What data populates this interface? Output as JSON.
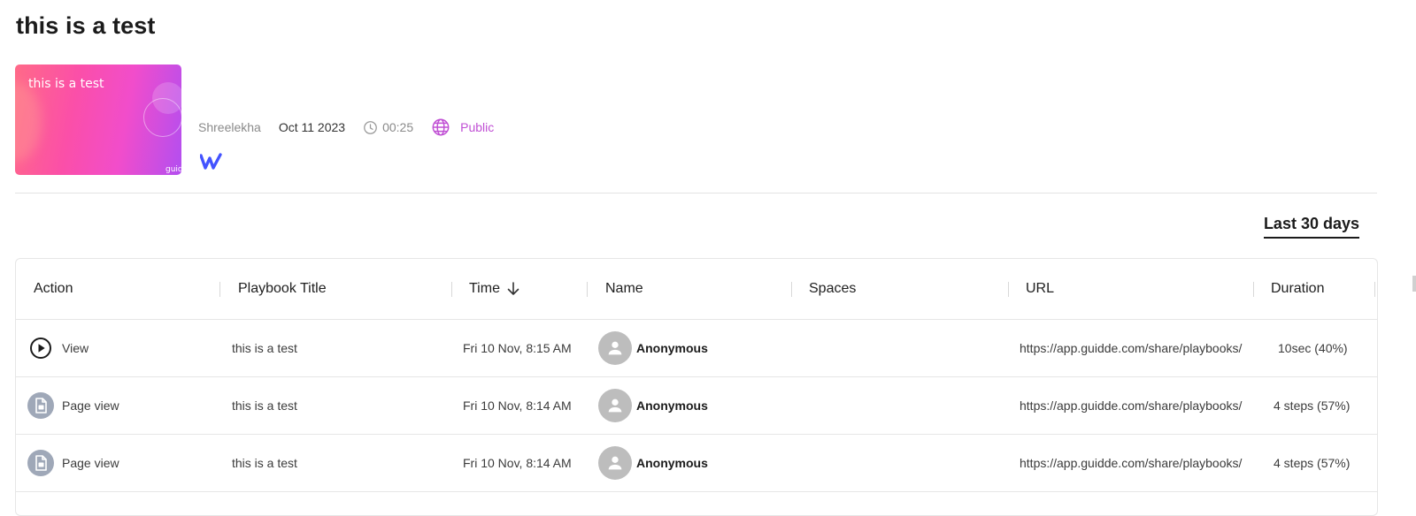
{
  "page": {
    "title": "this is a test"
  },
  "thumbnail": {
    "title": "this is a test",
    "brand": "guidde"
  },
  "meta": {
    "author": "Shreelekha",
    "date": "Oct 11 2023",
    "duration": "00:25",
    "visibility": "Public",
    "app_icon": "webflow-logo-icon"
  },
  "filters": {
    "range": "Last 30 days"
  },
  "colors": {
    "visibility": "#c04fd4",
    "webflow": "#4353ff",
    "avatar": "#bdbdbd",
    "page_view_icon": "#9fa8b8"
  },
  "table": {
    "columns": [
      "Action",
      "Playbook Title",
      "Time",
      "Name",
      "Spaces",
      "URL",
      "Duration"
    ],
    "sort_icon": "arrow-down-icon",
    "rows": [
      {
        "action": "View",
        "action_icon": "play-circle-icon",
        "title": "this is a test",
        "time": "Fri 10 Nov, 8:15 AM",
        "name": "Anonymous",
        "spaces": "",
        "url": "https://app.guidde.com/share/playbooks/",
        "duration": "10sec (40%)"
      },
      {
        "action": "Page view",
        "action_icon": "page-view-icon",
        "title": "this is a test",
        "time": "Fri 10 Nov, 8:14 AM",
        "name": "Anonymous",
        "spaces": "",
        "url": "https://app.guidde.com/share/playbooks/",
        "duration": "4 steps (57%)"
      },
      {
        "action": "Page view",
        "action_icon": "page-view-icon",
        "title": "this is a test",
        "time": "Fri 10 Nov, 8:14 AM",
        "name": "Anonymous",
        "spaces": "",
        "url": "https://app.guidde.com/share/playbooks/",
        "duration": "4 steps (57%)"
      }
    ]
  }
}
